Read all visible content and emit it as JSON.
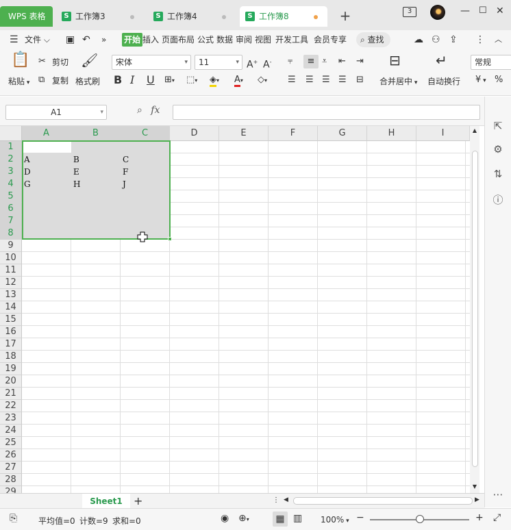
{
  "tabs": {
    "app": "WPS 表格",
    "docs": [
      {
        "label": "工作簿3",
        "active": false
      },
      {
        "label": "工作簿4",
        "active": false
      },
      {
        "label": "工作簿8",
        "active": true
      }
    ],
    "badge": "3"
  },
  "menu": {
    "file": "文件",
    "items": [
      "开始",
      "插入",
      "页面布局",
      "公式",
      "数据",
      "审阅",
      "视图",
      "开发工具",
      "会员专享"
    ],
    "search": "查找"
  },
  "ribbon": {
    "paste": "粘贴",
    "cut": "剪切",
    "copy": "复制",
    "format_painter": "格式刷",
    "font_name": "宋体",
    "font_size": "11",
    "merge_center": "合并居中",
    "wrap_text": "自动换行",
    "number_format": "常规",
    "currency": "¥"
  },
  "formula": {
    "name_box": "A1",
    "fx": "fx",
    "value": ""
  },
  "columns": [
    "A",
    "B",
    "C",
    "D",
    "E",
    "F",
    "G",
    "H",
    "I"
  ],
  "rows": [
    "1",
    "2",
    "3",
    "4",
    "5",
    "6",
    "7",
    "8",
    "9",
    "10",
    "11",
    "12",
    "13",
    "14",
    "15",
    "16",
    "17",
    "18",
    "19",
    "20",
    "21",
    "22",
    "23",
    "24",
    "25",
    "26",
    "27",
    "28",
    "29"
  ],
  "cells": {
    "A2": "A",
    "B2": "B",
    "C2": "C",
    "A3": "D",
    "B3": "E",
    "C3": "F",
    "A4": "G",
    "B4": "H",
    "C4": "J"
  },
  "sheet": {
    "name": "Sheet1"
  },
  "status": {
    "average": "平均值=0",
    "count": "计数=9",
    "sum": "求和=0",
    "zoom": "100%"
  },
  "colors": {
    "accent": "#4db04f"
  }
}
